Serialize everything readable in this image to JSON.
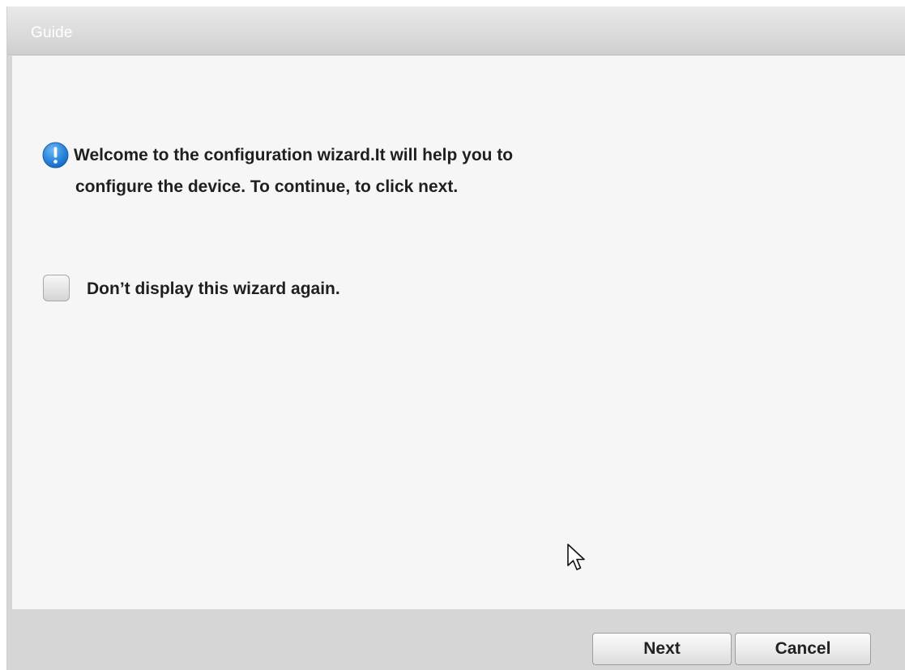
{
  "dialog": {
    "title": "Guide",
    "message_line1": "Welcome to the configuration wizard.It will help you to",
    "message_line2": "configure the device. To continue, to click next.",
    "checkbox_label": "Don’t display this wizard again.",
    "checkbox_checked": false
  },
  "buttons": {
    "next_label": "Next",
    "cancel_label": "Cancel"
  },
  "icons": {
    "info": "info-icon",
    "cursor": "mouse-pointer-icon"
  },
  "colors": {
    "info_icon": "#1f7fd8",
    "content_bg": "#f6f6f6",
    "frame_bg": "#d6d6d6",
    "title_text": "#ffffff"
  }
}
